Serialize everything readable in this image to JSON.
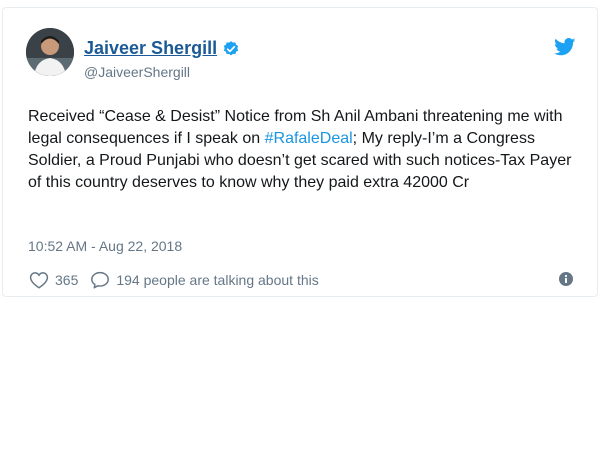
{
  "tweet": {
    "author_name": "Jaiveer Shergill",
    "author_handle": "@JaiveerShergill",
    "text_before": "Received “Cease & Desist” Notice from Sh Anil Ambani threatening me with legal consequences if I speak on ",
    "hashtag": "#RafaleDeal",
    "text_after": "; My reply-I’m a Congress Soldier, a Proud Punjabi who doesn’t get scared with such notices-Tax Payer of this country deserves to know why they paid extra 42000 Cr",
    "timestamp": "10:52 AM - Aug 22, 2018",
    "likes": "365",
    "talking": "194 people are talking about this"
  },
  "icons": {
    "avatar": "profile-photo",
    "verified": "verified-badge-icon",
    "bird": "twitter-bird-icon",
    "like": "heart-icon",
    "reply": "speech-bubble-icon",
    "info": "info-icon"
  },
  "colors": {
    "name": "#1b5a96",
    "hashtag": "#1b95e0",
    "muted": "#657786",
    "twitter_blue": "#1da1f2"
  }
}
